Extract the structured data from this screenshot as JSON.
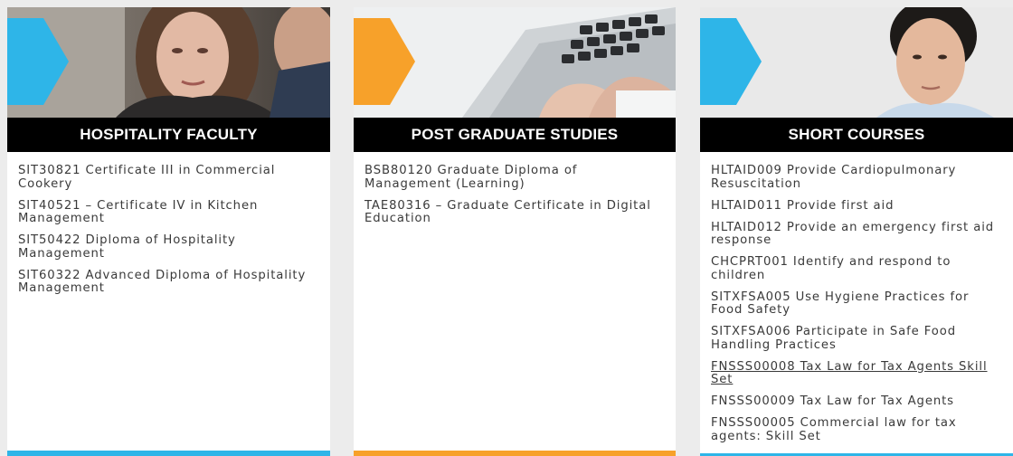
{
  "accent_colors": {
    "hospitality": "#2eb5e8",
    "postgraduate": "#f7a12a",
    "short_courses": "#2eb5e8"
  },
  "cards": [
    {
      "title": "HOSPITALITY FACULTY",
      "image": "woman-reading-photo",
      "items": [
        {
          "text": "SIT30821 Certificate III in Commercial Cookery",
          "link": false
        },
        {
          "text": "SIT40521 – Certificate IV in Kitchen Management",
          "link": false
        },
        {
          "text": "SIT50422 Diploma of Hospitality Management",
          "link": false
        },
        {
          "text": "SIT60322 Advanced Diploma of Hospitality Management",
          "link": false
        }
      ]
    },
    {
      "title": "POST GRADUATE STUDIES",
      "image": "hands-on-laptop-photo",
      "items": [
        {
          "text": "BSB80120 Graduate Diploma of Management (Learning)",
          "link": false
        },
        {
          "text": "TAE80316 – Graduate Certificate in Digital Education",
          "link": false
        }
      ]
    },
    {
      "title": "SHORT COURSES",
      "image": "young-man-portrait-photo",
      "items": [
        {
          "text": "HLTAID009 Provide Cardiopulmonary Resuscitation",
          "link": false
        },
        {
          "text": "HLTAID011 Provide first aid",
          "link": false
        },
        {
          "text": "HLTAID012 Provide an emergency first aid response",
          "link": false
        },
        {
          "text": "CHCPRT001 Identify and respond to children",
          "link": false
        },
        {
          "text": "SITXFSA005 Use Hygiene Practices for Food Safety",
          "link": false
        },
        {
          "text": "SITXFSA006 Participate in Safe Food Handling Practices",
          "link": false
        },
        {
          "text": "FNSSS00008 Tax Law for Tax Agents Skill Set",
          "link": true
        },
        {
          "text": "FNSSS00009 Tax Law for Tax Agents",
          "link": false
        },
        {
          "text": "FNSSS00005 Commercial law for tax agents: Skill Set",
          "link": false
        }
      ]
    }
  ]
}
